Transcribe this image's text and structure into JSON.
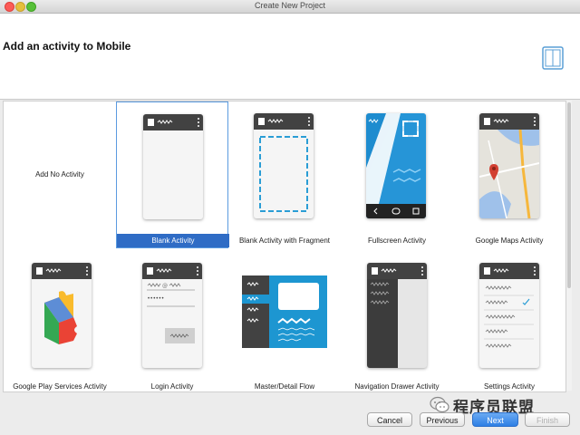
{
  "window": {
    "title": "Create New Project"
  },
  "header": {
    "title": "Add an activity to Mobile",
    "icon": "device-icon"
  },
  "activities": [
    {
      "label": "Add No Activity",
      "selected": false
    },
    {
      "label": "Blank Activity",
      "selected": true
    },
    {
      "label": "Blank Activity with Fragment",
      "selected": false
    },
    {
      "label": "Fullscreen Activity",
      "selected": false
    },
    {
      "label": "Google Maps Activity",
      "selected": false
    },
    {
      "label": "Google Play Services Activity",
      "selected": false
    },
    {
      "label": "Login Activity",
      "selected": false
    },
    {
      "label": "Master/Detail Flow",
      "selected": false
    },
    {
      "label": "Navigation Drawer Activity",
      "selected": false
    },
    {
      "label": "Settings Activity",
      "selected": false
    }
  ],
  "login": {
    "password_mask": "••••••"
  },
  "buttons": {
    "cancel": "Cancel",
    "previous": "Previous",
    "next": "Next",
    "finish": "Finish"
  },
  "watermark": {
    "text": "程序员联盟"
  },
  "colors": {
    "selection": "#2f6cc5",
    "appbar": "#424242",
    "fullscreen": "#1e8ccf",
    "master_detail": "#1d96d1",
    "primary_button": "#2e7fe5"
  }
}
